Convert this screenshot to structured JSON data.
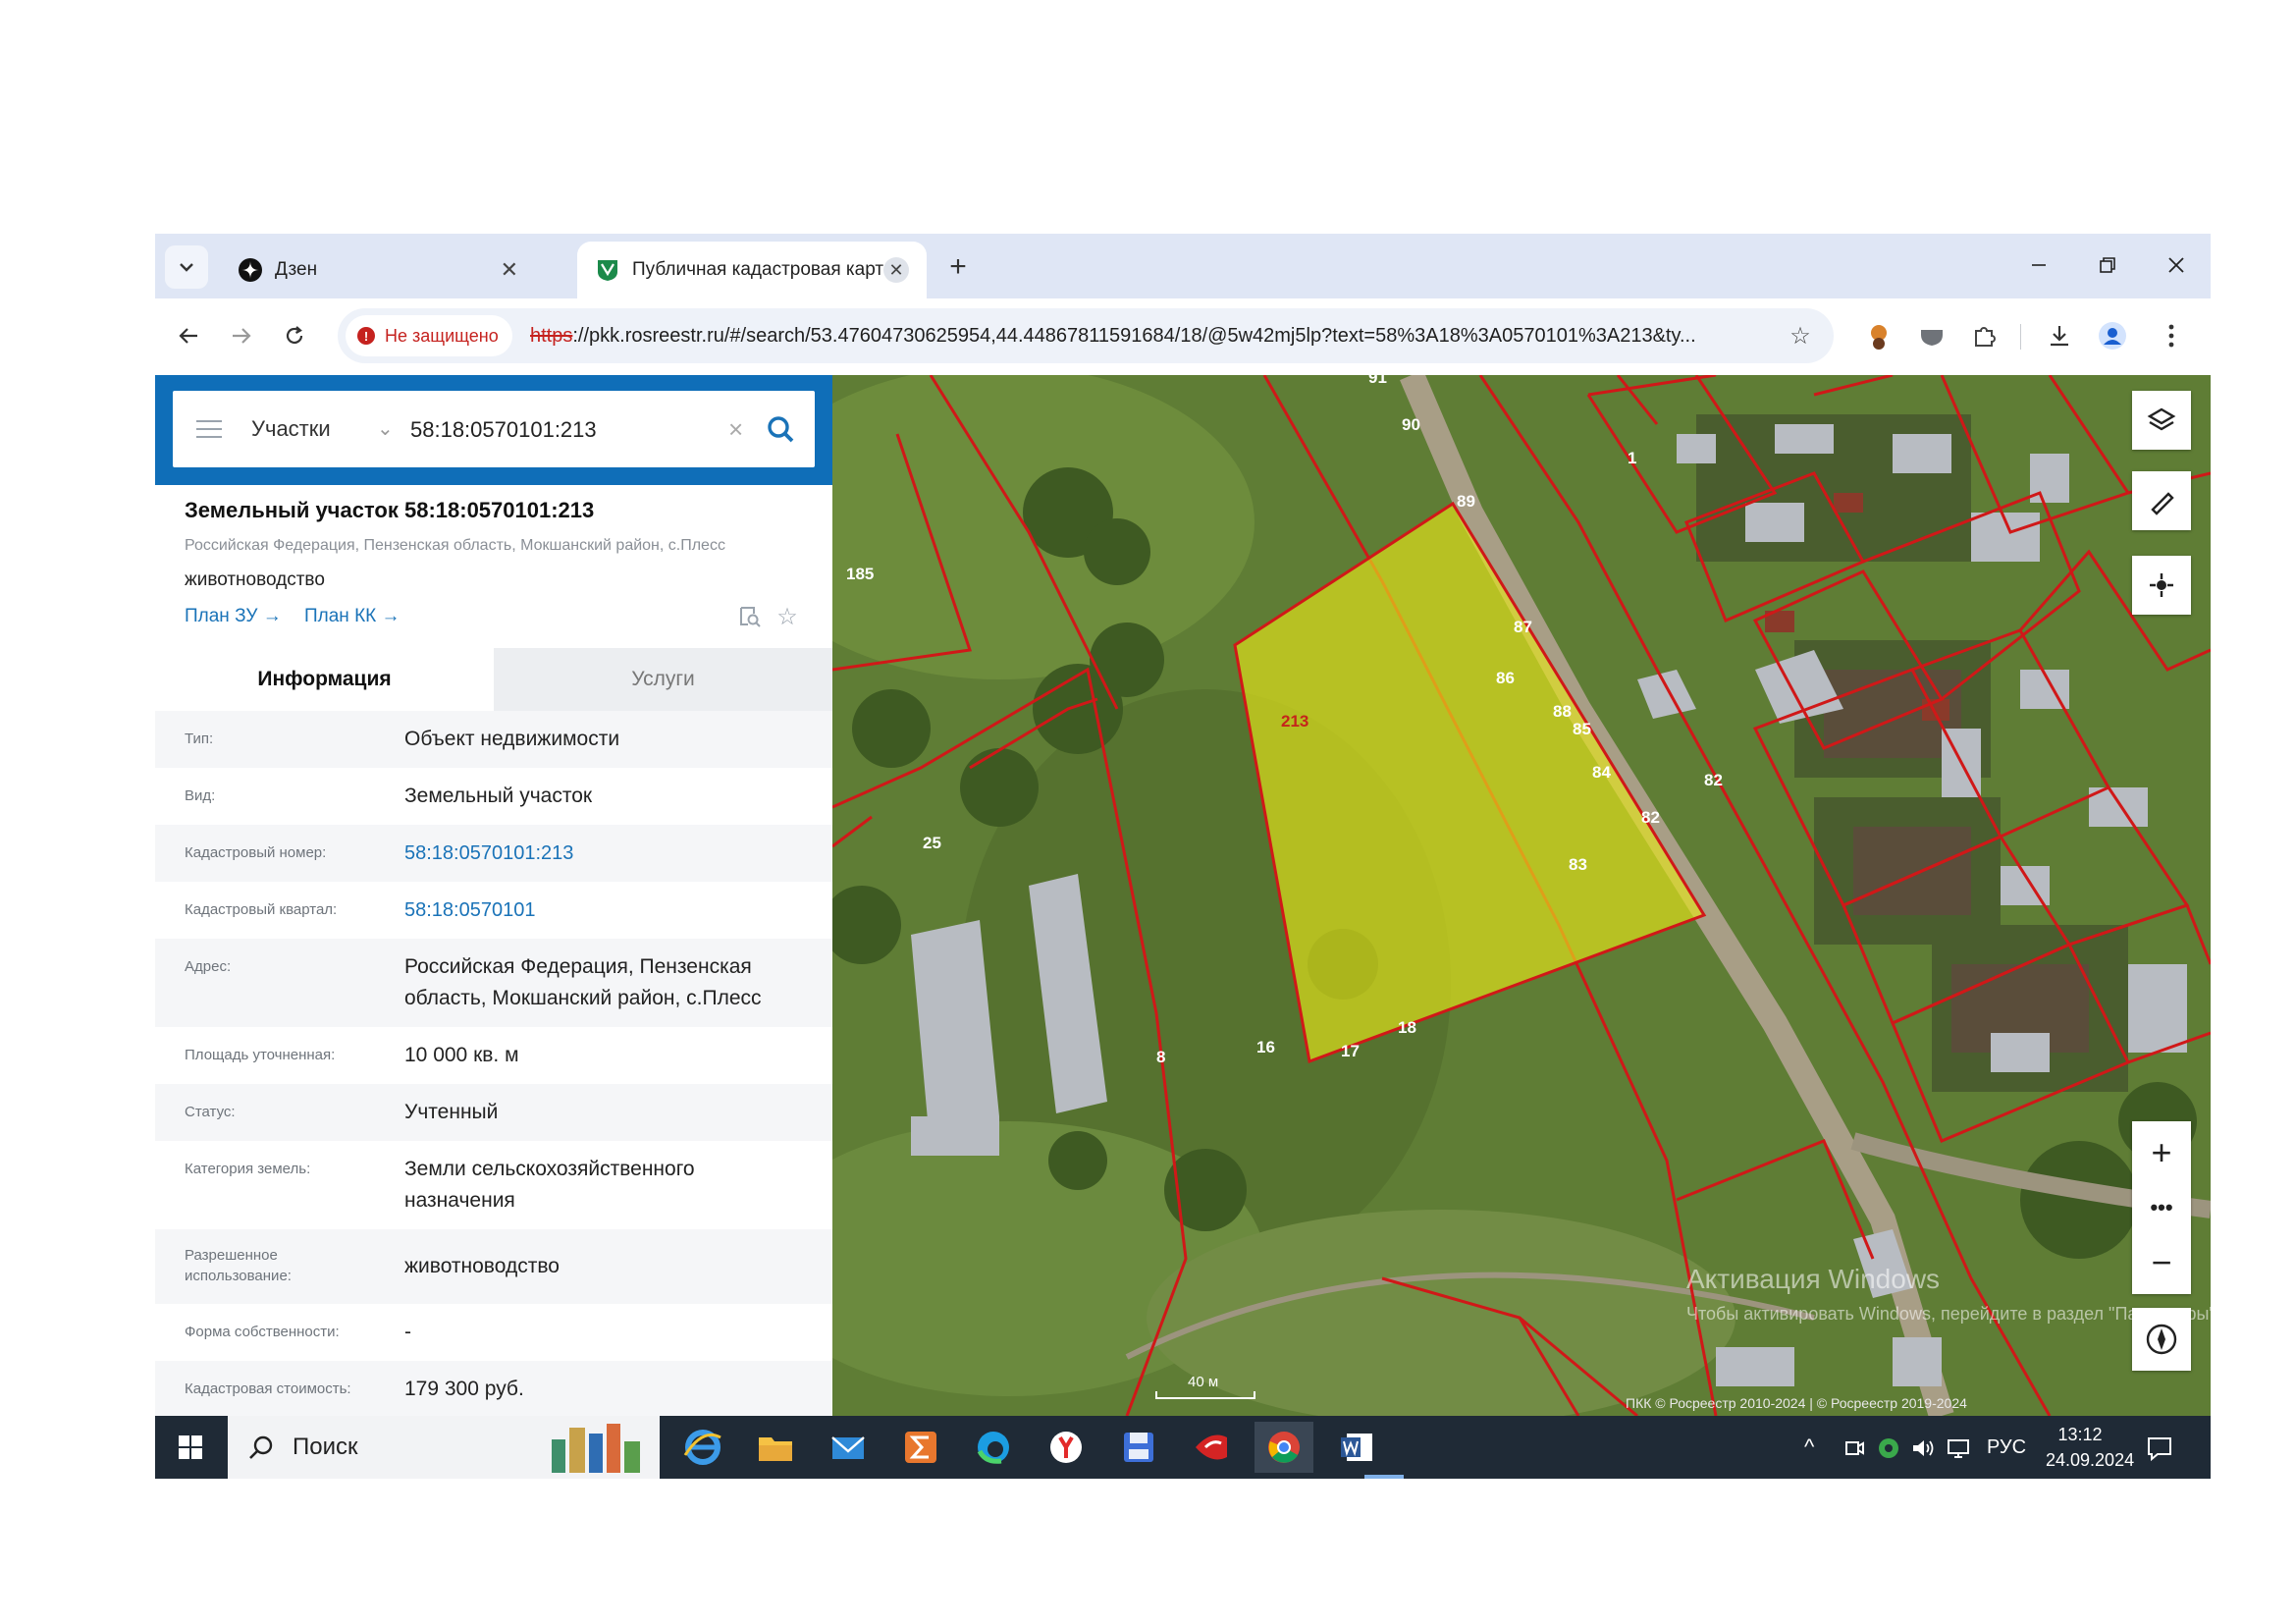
{
  "browser": {
    "tabs": [
      {
        "title": "Дзен",
        "icon": "dzen-icon",
        "active": false
      },
      {
        "title": "Публичная кадастровая карта",
        "icon": "rosreestr-icon",
        "active": true
      }
    ],
    "security_label": "Не защищено",
    "url_protocol": "https",
    "url_rest": "://pkk.rosreestr.ru/#/search/53.47604730625954,44.44867811591684/18/@5w42mj5lp?text=58%3A18%3A0570101%3A213&ty..."
  },
  "search": {
    "type_label": "Участки",
    "query": "58:18:0570101:213"
  },
  "object": {
    "title": "Земельный участок 58:18:0570101:213",
    "address": "Российская Федерация, Пензенская область, Мокшанский район, с.Плесс",
    "use": "животноводство",
    "links": [
      "План ЗУ →",
      "План КК →"
    ]
  },
  "panel_tabs": [
    "Информация",
    "Услуги"
  ],
  "info_rows": [
    {
      "label": "Тип:",
      "value": "Объект недвижимости"
    },
    {
      "label": "Вид:",
      "value": "Земельный участок"
    },
    {
      "label": "Кадастровый номер:",
      "value": "58:18:0570101:213"
    },
    {
      "label": "Кадастровый квартал:",
      "value": "58:18:0570101"
    },
    {
      "label": "Адрес:",
      "value": "Российская Федерация, Пензенская область, Мокшанский район, с.Плесс"
    },
    {
      "label": "Площадь уточненная:",
      "value": "10 000 кв. м"
    },
    {
      "label": "Статус:",
      "value": "Учтенный"
    },
    {
      "label": "Категория земель:",
      "value": "Земли сельскохозяйственного назначения"
    },
    {
      "label": "Разрешенное использование:",
      "value": "животноводство"
    },
    {
      "label": "Форма собственности:",
      "value": "-"
    },
    {
      "label": "Кадастровая стоимость:",
      "value": "179 300 руб."
    }
  ],
  "map": {
    "parcel_labels": [
      "213",
      "185",
      "25",
      "91",
      "90",
      "89",
      "1",
      "87",
      "86",
      "88",
      "85",
      "84",
      "82",
      "82",
      "83",
      "18",
      "16",
      "17",
      "8"
    ],
    "scale": "40 м",
    "attribution": "ПКК © Росреестр 2010-2024 | © Росреестр 2019-2024",
    "watermark_line1": "Активация Windows",
    "watermark_line2": "Чтобы активировать Windows, перейдите в раздел \"Параметры\"."
  },
  "taskbar": {
    "search_label": "Поиск",
    "language": "РУС",
    "time": "13:12",
    "date": "24.09.2024"
  },
  "colors": {
    "accent": "#0f6eb8",
    "parcel_fill": "#e6e61a",
    "parcel_border": "#d01818",
    "link": "#1a73b8"
  }
}
